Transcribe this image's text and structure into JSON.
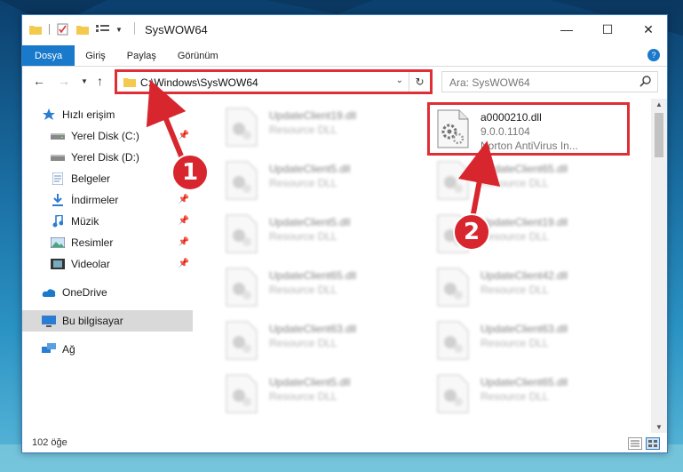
{
  "window": {
    "title": "SysWOW64",
    "minimize": "—",
    "maximize": "☐",
    "close": "✕"
  },
  "ribbon": {
    "tabs": [
      "Dosya",
      "Giriş",
      "Paylaş",
      "Görünüm"
    ],
    "active_tab": "Dosya"
  },
  "address": {
    "path": "C:\\Windows\\SysWOW64",
    "search_placeholder": "Ara: SysWOW64"
  },
  "sidebar": {
    "items": [
      {
        "label": "Hızlı erişim",
        "icon": "star-icon",
        "pinned": false
      },
      {
        "label": "Yerel Disk (C:)",
        "icon": "drive-icon",
        "pinned": true
      },
      {
        "label": "Yerel Disk (D:)",
        "icon": "drive-icon",
        "pinned": false
      },
      {
        "label": "Belgeler",
        "icon": "document-icon",
        "pinned": true
      },
      {
        "label": "İndirmeler",
        "icon": "download-icon",
        "pinned": true
      },
      {
        "label": "Müzik",
        "icon": "music-icon",
        "pinned": true
      },
      {
        "label": "Resimler",
        "icon": "pictures-icon",
        "pinned": true
      },
      {
        "label": "Videolar",
        "icon": "video-icon",
        "pinned": true
      },
      {
        "label": "OneDrive",
        "icon": "cloud-icon",
        "pinned": false
      },
      {
        "label": "Bu bilgisayar",
        "icon": "computer-icon",
        "pinned": false,
        "selected": true
      },
      {
        "label": "Ağ",
        "icon": "network-icon",
        "pinned": false
      }
    ]
  },
  "files": {
    "highlighted": {
      "name": "a0000210.dll",
      "version": "9.0.0.1104",
      "company": "Norton AntiVirus In..."
    },
    "left_column": [
      {
        "name": "UpdateClient19.dll",
        "desc": "Resource DLL"
      },
      {
        "name": "UpdateClient5.dll",
        "desc": "Resource DLL"
      },
      {
        "name": "UpdateClient5.dll",
        "desc": "Resource DLL"
      },
      {
        "name": "UpdateClient65.dll",
        "desc": "Resource DLL"
      },
      {
        "name": "UpdateClient63.dll",
        "desc": "Resource DLL"
      },
      {
        "name": "UpdateClient5.dll",
        "desc": "Resource DLL"
      }
    ],
    "right_column": [
      {
        "name": "UpdateClient65.dll",
        "desc": "Resource DLL"
      },
      {
        "name": "UpdateClient19.dll",
        "desc": "Resource DLL"
      },
      {
        "name": "UpdateClient42.dll",
        "desc": "Resource DLL"
      },
      {
        "name": "UpdateClient63.dll",
        "desc": "Resource DLL"
      },
      {
        "name": "UpdateClient65.dll",
        "desc": "Resource DLL"
      }
    ]
  },
  "status": {
    "item_count": "102 öğe"
  },
  "callouts": [
    "1",
    "2"
  ],
  "colors": {
    "accent": "#1979ca",
    "annotation": "#e02e37"
  }
}
